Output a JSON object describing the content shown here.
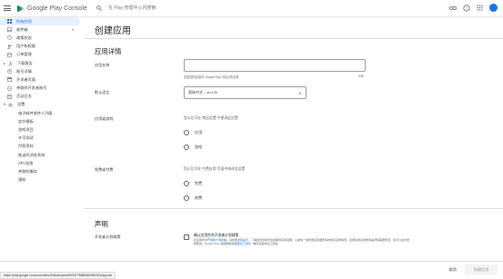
{
  "header": {
    "app_name": "Google Play Console",
    "search_placeholder": "在 Play 管理中心内搜索",
    "icons": [
      "menu-icon",
      "google-play-logo-icon",
      "search-icon",
      "link-icon",
      "help-icon",
      "apps-grid-icon",
      "avatar"
    ]
  },
  "sidebar": {
    "items": [
      {
        "label": "所有应用",
        "icon": "grid-icon",
        "active": true
      },
      {
        "label": "收件箱",
        "icon": "inbox-icon",
        "count": "3"
      },
      {
        "label": "政策状态",
        "icon": "shield-icon"
      },
      {
        "label": "用户和权限",
        "icon": "people-icon"
      },
      {
        "label": "订单管理",
        "icon": "order-icon"
      },
      {
        "label": "下载报告",
        "icon": "download-icon",
        "expandable": true
      },
      {
        "label": "账号详情",
        "icon": "account-icon"
      },
      {
        "label": "开发者页面",
        "icon": "page-icon"
      },
      {
        "label": "关联的开发者账号",
        "icon": "link-icon"
      },
      {
        "label": "活动日志",
        "icon": "log-icon"
      },
      {
        "label": "设置",
        "icon": "gear-icon",
        "expandable": true
      },
      {
        "label": "电子邮件收件人列表"
      },
      {
        "label": "定价模板"
      },
      {
        "label": "游戏项目"
      },
      {
        "label": "许可测试"
      },
      {
        "label": "付款资料"
      },
      {
        "label": "推送的消息系统"
      },
      {
        "label": "API 权限"
      },
      {
        "label": "关联的服务"
      },
      {
        "label": "通知"
      }
    ]
  },
  "main": {
    "page_title": "创建应用",
    "app_details": {
      "section_title": "应用详情",
      "app_name_label": "应用名称",
      "app_name_value": "",
      "app_name_hint": "这是您的应用在 Google Play 中显示的名称",
      "app_name_counter": "0/30",
      "default_language_label": "默认语言",
      "default_language_value": "简体中文 – zh-CN",
      "app_or_game_label": "应用或游戏",
      "app_or_game_desc": "您以后可在\"商店设置\"中更改此设置",
      "app_or_game_options": [
        "应用",
        "游戏"
      ],
      "free_or_paid_label": "免费或付费",
      "free_or_paid_desc": "您以后可在\"付费应用\"页面中修改此设置",
      "free_or_paid_options": [
        "免费",
        "收费"
      ]
    },
    "declarations": {
      "section_title": "声明",
      "dev_policy_label": "开发者计划政策",
      "dev_policy_checkbox": "确认应用符合开发者计划政策",
      "dev_policy_sub_1": "此应用符合",
      "dev_policy_sub_link_1": "开发者计划政策",
      "dev_policy_sub_2": "。请参阅",
      "dev_policy_sub_link_2": "这些提示",
      "dev_policy_sub_3": "，了解如何创建符合政策的应用说明，以避免一些导致应用遭暂停的常见违规情形。如果您的应用或商品详情需要修改，您可以在付费前更改。Google Play 会根据各项",
      "dev_policy_sub_link_3": "美国出口法律",
      "dev_policy_sub_4": "，确定应用的出口资格。"
    }
  },
  "footer": {
    "status_url": "https://play.google.com/console/u/0/developers/6093778868484981303/app-list",
    "cancel_label": "取消",
    "create_label": "创建应用"
  }
}
